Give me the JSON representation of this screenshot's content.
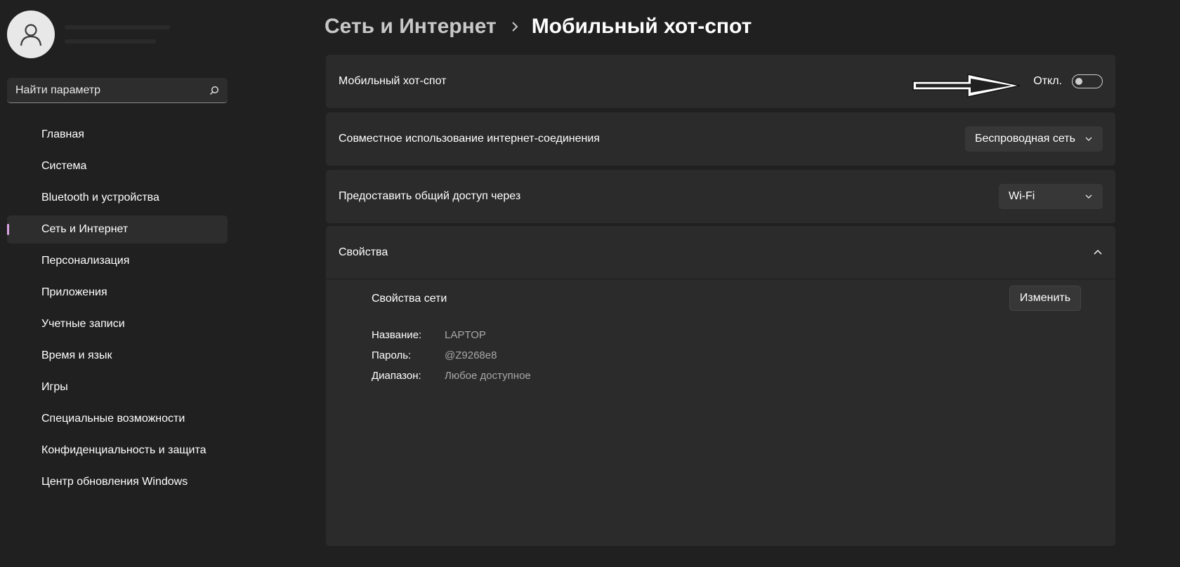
{
  "sidebar": {
    "search": {
      "placeholder": "Найти параметр",
      "icon": "search-icon"
    },
    "items": [
      {
        "label": "Главная",
        "active": false
      },
      {
        "label": "Система",
        "active": false
      },
      {
        "label": "Bluetooth и устройства",
        "active": false
      },
      {
        "label": "Сеть и Интернет",
        "active": true
      },
      {
        "label": "Персонализация",
        "active": false
      },
      {
        "label": "Приложения",
        "active": false
      },
      {
        "label": "Учетные записи",
        "active": false
      },
      {
        "label": "Время и язык",
        "active": false
      },
      {
        "label": "Игры",
        "active": false
      },
      {
        "label": "Специальные возможности",
        "active": false
      },
      {
        "label": "Конфиденциальность и защита",
        "active": false
      },
      {
        "label": "Центр обновления Windows",
        "active": false
      }
    ],
    "accent_color": "#d9a3e3"
  },
  "header": {
    "parent": "Сеть и Интернет",
    "current": "Мобильный хот-спот"
  },
  "hotspot": {
    "label": "Мобильный хот-спот",
    "toggle_state": "Откл.",
    "enabled": false
  },
  "sharing": {
    "label": "Совместное использование интернет-соединения",
    "value": "Беспроводная сеть"
  },
  "share_via": {
    "label": "Предоставить общий доступ через",
    "value": "Wi-Fi"
  },
  "properties": {
    "label": "Свойства",
    "network_title": "Свойства сети",
    "edit_label": "Изменить",
    "rows": [
      {
        "key": "Название:",
        "value": "LAPTOP"
      },
      {
        "key": "Пароль:",
        "value": "@Z9268e8"
      },
      {
        "key": "Диапазон:",
        "value": "Любое доступное"
      }
    ]
  }
}
